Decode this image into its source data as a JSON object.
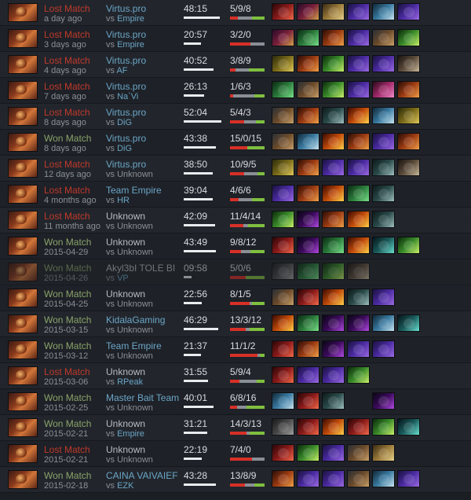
{
  "matches": [
    {
      "result": "Lost Match",
      "outcome": "lost",
      "date": "a day ago",
      "team": "Virtus.pro",
      "team_link": true,
      "opponent": "Empire",
      "opponent_link": true,
      "duration": "48:15",
      "dur_frac": 0.95,
      "kda": "5/9/8",
      "k": 5,
      "d": 9,
      "a": 8,
      "items": [
        "i-red",
        "i-crown",
        "i-scroll",
        "i-purple",
        "i-boots",
        "i-purple"
      ]
    },
    {
      "result": "Lost Match",
      "outcome": "lost",
      "date": "3 days ago",
      "team": "Virtus.pro",
      "team_link": true,
      "opponent": "Empire",
      "opponent_link": true,
      "duration": "20:57",
      "dur_frac": 0.45,
      "kda": "3/2/0",
      "k": 3,
      "d": 2,
      "a": 0,
      "items": [
        "i-crown",
        "i-ring",
        "i-helm",
        "i-purple",
        "i-axe",
        "i-spear"
      ]
    },
    {
      "result": "Lost Match",
      "outcome": "lost",
      "date": "4 days ago",
      "team": "Virtus.pro",
      "team_link": true,
      "opponent": "AF",
      "opponent_link": true,
      "duration": "40:52",
      "dur_frac": 0.8,
      "kda": "3/8/9",
      "k": 3,
      "d": 8,
      "a": 9,
      "items": [
        "i-ward",
        "i-helm",
        "i-spear",
        "i-purple",
        "i-purple",
        "i-stone"
      ]
    },
    {
      "result": "Lost Match",
      "outcome": "lost",
      "date": "7 days ago",
      "team": "Virtus.pro",
      "team_link": true,
      "opponent": "Na`Vi",
      "opponent_link": true,
      "duration": "26:13",
      "dur_frac": 0.55,
      "kda": "1/6/3",
      "k": 1,
      "d": 6,
      "a": 3,
      "items": [
        "i-ring",
        "i-axe",
        "i-spear",
        "i-purple",
        "i-pink",
        "i-helm"
      ]
    },
    {
      "result": "Lost Match",
      "outcome": "lost",
      "date": "8 days ago",
      "team": "Virtus.pro",
      "team_link": true,
      "opponent": "DiG",
      "opponent_link": true,
      "duration": "52:04",
      "dur_frac": 1.0,
      "kda": "5/4/3",
      "k": 5,
      "d": 4,
      "a": 3,
      "items": [
        "i-axe",
        "i-helm",
        "i-skull",
        "i-fire",
        "i-boots",
        "i-ward"
      ]
    },
    {
      "result": "Won Match",
      "outcome": "won",
      "date": "8 days ago",
      "team": "Virtus.pro",
      "team_link": true,
      "opponent": "DiG",
      "opponent_link": true,
      "duration": "43:38",
      "dur_frac": 0.85,
      "kda": "15/0/15",
      "k": 15,
      "d": 0,
      "a": 15,
      "items": [
        "i-axe",
        "i-boots",
        "i-fire",
        "i-helm",
        "i-purple",
        "i-helm"
      ]
    },
    {
      "result": "Lost Match",
      "outcome": "lost",
      "date": "12 days ago",
      "team": "Virtus.pro",
      "team_link": true,
      "opponent": "Unknown",
      "opponent_link": false,
      "duration": "38:50",
      "dur_frac": 0.77,
      "kda": "10/9/5",
      "k": 10,
      "d": 9,
      "a": 5,
      "items": [
        "i-ward",
        "i-helm",
        "i-purple",
        "i-purple",
        "i-skull",
        "i-stone"
      ]
    },
    {
      "result": "Lost Match",
      "outcome": "lost",
      "date": "4 months ago",
      "team": "Team Empire",
      "team_link": true,
      "opponent": "HR",
      "opponent_link": true,
      "duration": "39:04",
      "dur_frac": 0.78,
      "kda": "4/6/6",
      "k": 4,
      "d": 6,
      "a": 6,
      "items": [
        "i-purple",
        "i-helm",
        "i-fire",
        "i-ring",
        "i-skull",
        "i-empty"
      ]
    },
    {
      "result": "Lost Match",
      "outcome": "lost",
      "date": "11 months ago",
      "team": "Unknown",
      "team_link": false,
      "opponent": "Unknown",
      "opponent_link": false,
      "duration": "42:09",
      "dur_frac": 0.83,
      "kda": "11/4/14",
      "k": 11,
      "d": 4,
      "a": 14,
      "items": [
        "i-spear",
        "i-cross",
        "i-helm",
        "i-fire",
        "i-skull",
        "i-empty"
      ]
    },
    {
      "result": "Won Match",
      "outcome": "won",
      "date": "2015-04-29",
      "team": "Unknown",
      "team_link": false,
      "opponent": "Unknown",
      "opponent_link": false,
      "duration": "43:49",
      "dur_frac": 0.85,
      "kda": "9/8/12",
      "k": 9,
      "d": 8,
      "a": 12,
      "items": [
        "i-red",
        "i-cross",
        "i-ring",
        "i-fire",
        "i-orb",
        "i-spear"
      ]
    },
    {
      "result": "Won Match",
      "outcome": "won",
      "date": "2015-04-26",
      "team": "Akyl3bI TOLE BI",
      "team_link": false,
      "opponent": "VP",
      "opponent_link": true,
      "duration": "09:58",
      "dur_frac": 0.2,
      "kda": "5/0/6",
      "k": 5,
      "d": 0,
      "a": 6,
      "items": [
        "i-grey",
        "i-ring",
        "i-spear",
        "i-stone",
        "i-empty",
        "i-empty"
      ],
      "dim": true
    },
    {
      "result": "Won Match",
      "outcome": "won",
      "date": "2015-04-25",
      "team": "Unknown",
      "team_link": false,
      "opponent": "Unknown",
      "opponent_link": false,
      "duration": "22:56",
      "dur_frac": 0.47,
      "kda": "8/1/5",
      "k": 8,
      "d": 1,
      "a": 5,
      "items": [
        "i-axe",
        "i-red",
        "i-fire",
        "i-skull",
        "i-purple",
        "i-empty"
      ]
    },
    {
      "result": "Won Match",
      "outcome": "won",
      "date": "2015-03-15",
      "team": "KidalaGaming",
      "team_link": true,
      "opponent": "Unknown",
      "opponent_link": false,
      "duration": "46:29",
      "dur_frac": 0.91,
      "kda": "13/3/12",
      "k": 13,
      "d": 3,
      "a": 12,
      "items": [
        "i-fire",
        "i-ring",
        "i-cross",
        "i-cross",
        "i-boots",
        "i-orb"
      ]
    },
    {
      "result": "Won Match",
      "outcome": "won",
      "date": "2015-03-12",
      "team": "Team Empire",
      "team_link": true,
      "opponent": "Unknown",
      "opponent_link": false,
      "duration": "21:37",
      "dur_frac": 0.46,
      "kda": "11/1/2",
      "k": 11,
      "d": 1,
      "a": 2,
      "items": [
        "i-red",
        "i-helm",
        "i-cross",
        "i-purple",
        "i-purple",
        "i-empty"
      ]
    },
    {
      "result": "Lost Match",
      "outcome": "lost",
      "date": "2015-03-06",
      "team": "Unknown",
      "team_link": false,
      "opponent": "RPeak",
      "opponent_link": true,
      "duration": "31:55",
      "dur_frac": 0.64,
      "kda": "5/9/4",
      "k": 5,
      "d": 9,
      "a": 4,
      "items": [
        "i-red",
        "i-purple",
        "i-purple",
        "i-spear",
        "i-empty",
        "i-empty"
      ]
    },
    {
      "result": "Won Match",
      "outcome": "won",
      "date": "2015-02-25",
      "team": "Master Bait Team",
      "team_link": true,
      "opponent": "Unknown",
      "opponent_link": false,
      "duration": "40:01",
      "dur_frac": 0.79,
      "kda": "6/8/16",
      "k": 6,
      "d": 8,
      "a": 16,
      "items": [
        "i-boots",
        "i-red",
        "i-skull",
        "i-empty",
        "i-cross",
        "i-empty"
      ]
    },
    {
      "result": "Won Match",
      "outcome": "won",
      "date": "2015-02-21",
      "team": "Unknown",
      "team_link": false,
      "opponent": "Empire",
      "opponent_link": true,
      "duration": "31:21",
      "dur_frac": 0.63,
      "kda": "14/3/13",
      "k": 14,
      "d": 3,
      "a": 13,
      "items": [
        "i-grey",
        "i-red",
        "i-fire",
        "i-red",
        "i-spear",
        "i-orb"
      ]
    },
    {
      "result": "Lost Match",
      "outcome": "lost",
      "date": "2015-02-21",
      "team": "Unknown",
      "team_link": false,
      "opponent": "Unknown",
      "opponent_link": false,
      "duration": "22:19",
      "dur_frac": 0.47,
      "kda": "7/4/0",
      "k": 7,
      "d": 4,
      "a": 0,
      "items": [
        "i-red",
        "i-spear",
        "i-purple",
        "i-axe",
        "i-scroll",
        "i-empty"
      ]
    },
    {
      "result": "Won Match",
      "outcome": "won",
      "date": "2015-02-18",
      "team": "CAINA VAIVAIEF",
      "team_link": true,
      "opponent": "EZK",
      "opponent_link": true,
      "duration": "43:28",
      "dur_frac": 0.85,
      "kda": "13/8/9",
      "k": 13,
      "d": 8,
      "a": 9,
      "items": [
        "i-helm",
        "i-purple",
        "i-purple",
        "i-axe",
        "i-boots",
        "i-purple"
      ]
    }
  ],
  "vs_label": "vs"
}
